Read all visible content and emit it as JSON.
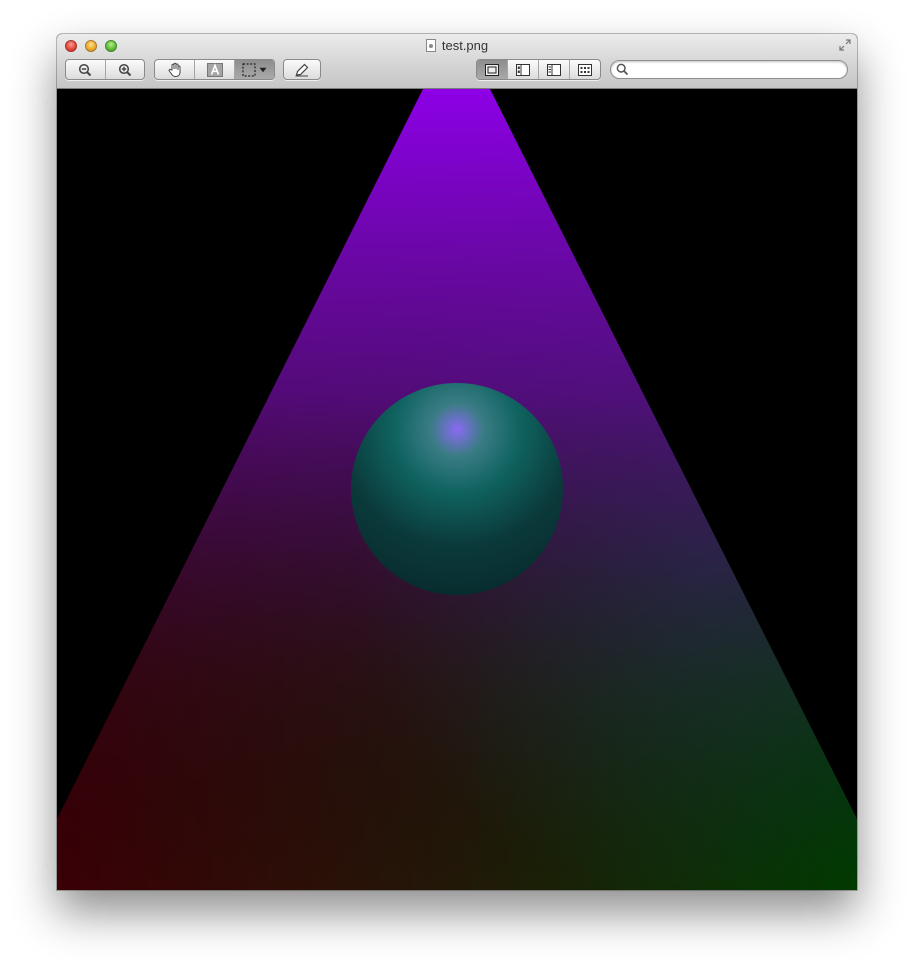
{
  "window": {
    "title": "test.png",
    "controls": [
      "close",
      "minimize",
      "zoom"
    ]
  },
  "toolbar": {
    "zoom_group": [
      {
        "name": "zoom-out",
        "icon": "zoom-out-icon"
      },
      {
        "name": "zoom-in",
        "icon": "zoom-in-icon"
      }
    ],
    "tools_group": [
      {
        "name": "move-tool",
        "icon": "hand-icon"
      },
      {
        "name": "text-select-tool",
        "icon": "text-select-icon"
      },
      {
        "name": "rect-select-tool",
        "icon": "selection-marquee-icon",
        "active": true,
        "has_menu": true
      }
    ],
    "markup": {
      "name": "annotate",
      "icon": "pencil-icon"
    },
    "view_group": [
      {
        "name": "content-only",
        "icon": "content-only-icon",
        "active": true
      },
      {
        "name": "thumbnails",
        "icon": "thumbnails-sidebar-icon"
      },
      {
        "name": "table-of-contents",
        "icon": "toc-sidebar-icon"
      },
      {
        "name": "contact-sheet",
        "icon": "contact-sheet-icon"
      }
    ],
    "search": {
      "value": "",
      "placeholder": ""
    }
  },
  "colors": {
    "spotlight_top": "#8c00e6",
    "bottom_left": "#3a0006",
    "bottom_right": "#003a00",
    "sphere": "#0f5a58",
    "sphere_highlight": "#8e6cf0",
    "background": "#000000"
  }
}
